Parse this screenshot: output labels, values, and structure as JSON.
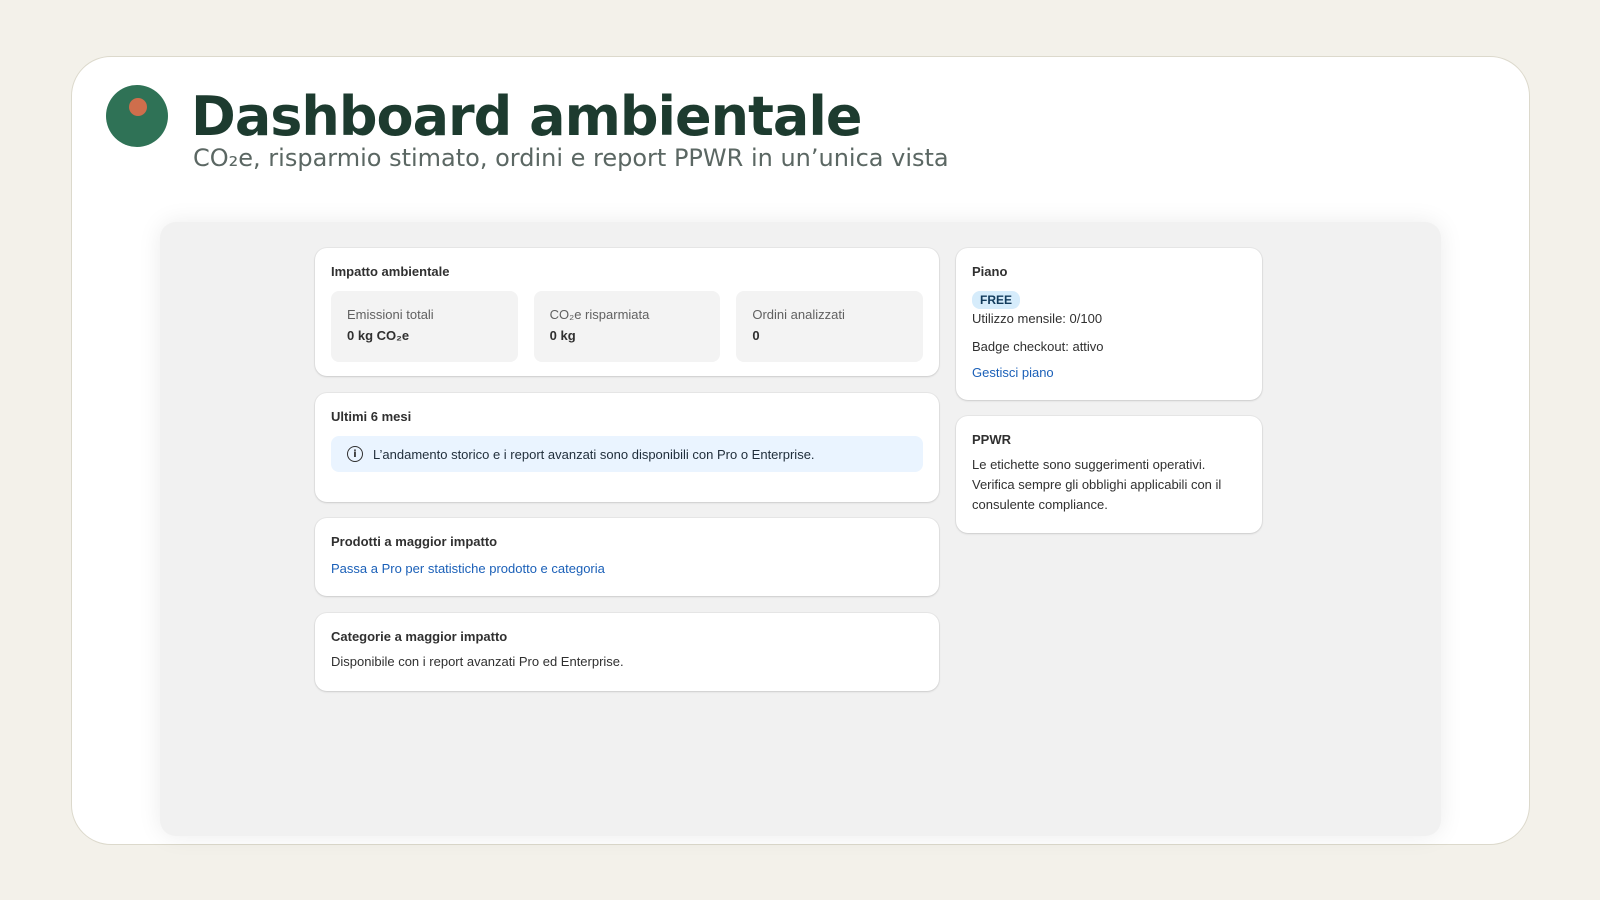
{
  "header": {
    "title": "Dashboard ambientale",
    "subtitle": "CO₂e, risparmio stimato, ordini e report PPWR in un’unica vista"
  },
  "impact": {
    "title": "Impatto ambientale",
    "metrics": [
      {
        "label": "Emissioni totali",
        "value": "0 kg CO₂e"
      },
      {
        "label": "CO₂e risparmiata",
        "value": "0 kg"
      },
      {
        "label": "Ordini analizzati",
        "value": "0"
      }
    ]
  },
  "history": {
    "title": "Ultimi 6 mesi",
    "banner": "L’andamento storico e i report avanzati sono disponibili con Pro o Enterprise.",
    "icon": "info-icon"
  },
  "products": {
    "title": "Prodotti a maggior impatto",
    "link": "Passa a Pro per statistiche prodotto e categoria"
  },
  "categories": {
    "title": "Categorie a maggior impatto",
    "text": "Disponibile con i report avanzati Pro ed Enterprise."
  },
  "plan": {
    "title": "Piano",
    "badge": "FREE",
    "usage": "Utilizzo mensile: 0/100",
    "badge_checkout": "Badge checkout: attivo",
    "manage_link": "Gestisci piano"
  },
  "ppwr": {
    "title": "PPWR",
    "text": "Le etichette sono suggerimenti operativi. Verifica sempre gli obblighi applicabili con il consulente compliance."
  },
  "colors": {
    "brand_green": "#2f7256",
    "brand_accent": "#cf6e4c",
    "link_blue": "#1b60b8"
  }
}
